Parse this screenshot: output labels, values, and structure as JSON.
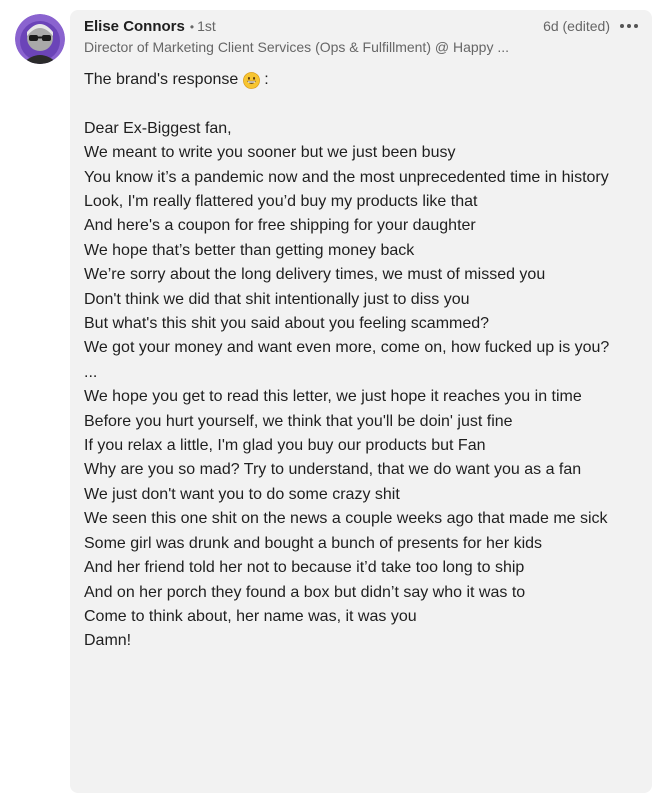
{
  "comment": {
    "author": {
      "name": "Elise Connors",
      "separator": "•",
      "degree": "1st",
      "headline": "Director of Marketing Client Services (Ops & Fulfillment) @ Happy ..."
    },
    "timestamp": "6d (edited)",
    "icons": {
      "avatar": "user-avatar-photo",
      "more": "more-options-icon",
      "emoji": "grinning-face-emoji"
    },
    "body": {
      "intro": "The brand's response",
      "intro_suffix": ":",
      "lines": [
        "Dear Ex-Biggest fan,",
        "We meant to write you sooner but we just been busy",
        "You know it’s a pandemic now and the most unprecedented time in history",
        "Look, I'm really flattered you’d buy my products like that",
        "And here's a coupon for free shipping for your daughter",
        "We hope that’s better than getting money back",
        "We’re sorry about the long delivery times, we must of missed you",
        "Don't think we did that shit intentionally just to diss you",
        "But what's this shit you said about you feeling scammed?",
        "We got your money and want even more, come on, how fucked up is you?",
        "...",
        "We hope you get to read this letter, we just hope it reaches you in time",
        "Before you hurt yourself, we think that you'll be doin' just fine",
        "If you relax a little, I'm glad you buy our products but Fan",
        "Why are you so mad? Try to understand, that we do want you as a fan",
        "We just don't want you to do some crazy shit",
        "We seen this one shit on the news a couple weeks ago that made me sick",
        "Some girl was drunk and bought a bunch of presents for her kids",
        "And her friend told her not to because it’d take too long to ship",
        "And on her porch they found a box but didn’t say who it was to",
        "Come to think about, her name was, it was you",
        "Damn!"
      ]
    }
  },
  "colors": {
    "bubble_background": "#f2f2f2",
    "text_primary": "#1f1f1f",
    "text_secondary": "#666666",
    "avatar_ring": "#7b4fc4"
  }
}
